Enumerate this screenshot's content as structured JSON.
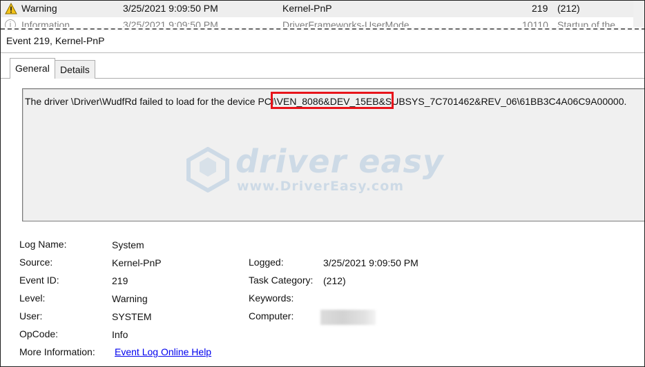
{
  "event_list": {
    "rows": [
      {
        "level": "Warning",
        "date": "3/25/2021 9:09:50 PM",
        "source": "Kernel-PnP",
        "event_id": "219",
        "task": "(212)"
      },
      {
        "level": "Information",
        "date": "3/25/2021 9:09:50 PM",
        "source": "DriverFrameworks-UserMode",
        "event_id": "10110",
        "task": "Startup of the"
      }
    ]
  },
  "event_title": "Event 219, Kernel-PnP",
  "tabs": {
    "general": "General",
    "details": "Details"
  },
  "message": {
    "prefix": "The driver \\Driver\\WudfRd failed to load for the device ",
    "highlighted": "PCI\\VEN_8086&DEV_15EB",
    "suffix": "&SUBSYS_7C701462&REV_06\\61BB3C4A06C9A00000."
  },
  "watermark": {
    "name": "driver easy",
    "url": "www.DriverEasy.com"
  },
  "properties": {
    "log_name": {
      "label": "Log Name:",
      "value": "System"
    },
    "source": {
      "label": "Source:",
      "value": "Kernel-PnP"
    },
    "event_id": {
      "label": "Event ID:",
      "value": "219"
    },
    "level": {
      "label": "Level:",
      "value": "Warning"
    },
    "user": {
      "label": "User:",
      "value": "SYSTEM"
    },
    "opcode": {
      "label": "OpCode:",
      "value": "Info"
    },
    "more_info": {
      "label": "More Information:",
      "value": "Event Log Online Help"
    },
    "logged": {
      "label": "Logged:",
      "value": "3/25/2021 9:09:50 PM"
    },
    "task_category": {
      "label": "Task Category:",
      "value": "(212)"
    },
    "keywords": {
      "label": "Keywords:",
      "value": ""
    },
    "computer": {
      "label": "Computer:",
      "value": ""
    }
  },
  "colors": {
    "highlight_border": "#e8141b",
    "link": "#0000ee",
    "watermark": "#8fb4d6"
  }
}
